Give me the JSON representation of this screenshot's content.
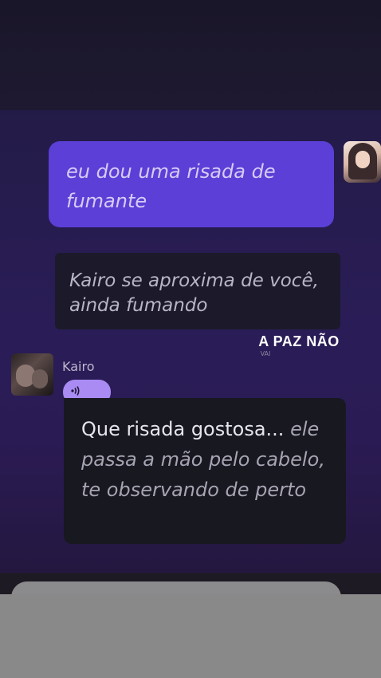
{
  "messages": {
    "user_message": "eu dou uma risada de fumante",
    "narration": "Kairo se aproxima de você, ainda fumando",
    "character": {
      "name": "Kairo",
      "speech": "Que risada gostosa...",
      "action": "ele passa a mão pelo cabelo, te observando de perto"
    }
  },
  "overlay_caption": {
    "title": "A PAZ NÃO",
    "subtitle": "VAI"
  },
  "icons": {
    "voice": "sound-wave-icon",
    "user_avatar": "user-avatar-icon",
    "character_avatar": "character-avatar-icon"
  },
  "colors": {
    "user_bubble": "#5b3fd6",
    "voice_button": "#a98bf3",
    "chat_background": "#2a1d57"
  }
}
